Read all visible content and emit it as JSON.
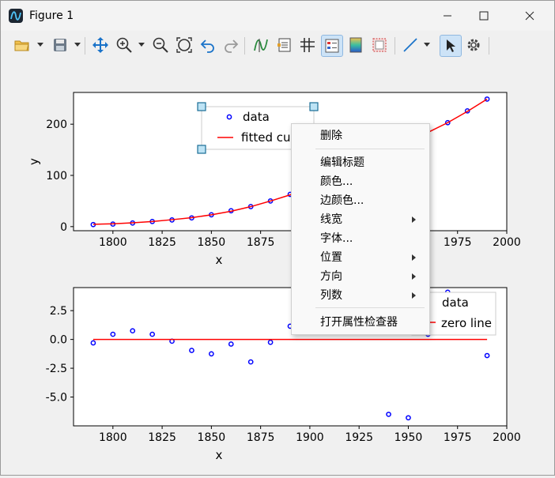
{
  "window": {
    "title": "Figure 1"
  },
  "toolbar": {
    "icons": [
      "open-icon",
      "save-icon",
      "pan-icon",
      "zoom-in-icon",
      "zoom-out-icon",
      "zoom-fit-icon",
      "undo-icon",
      "redo-icon",
      "edit-curve-icon",
      "edit-axes-icon",
      "grid-icon",
      "legend-icon",
      "colorbar-icon",
      "tight-layout-icon",
      "draw-line-icon",
      "pointer-icon",
      "settings-icon"
    ],
    "accent": "#1a73c9"
  },
  "plot_top": {
    "ylabel": "y",
    "xlabel": "x",
    "xticks": [
      "1800",
      "1825",
      "1850",
      "1875",
      "1900",
      "1925",
      "1950",
      "1975",
      "2000"
    ],
    "yticks": [
      "0",
      "100",
      "200"
    ],
    "legend": [
      "data",
      "fitted cu"
    ]
  },
  "plot_bottom": {
    "xlabel": "x",
    "xticks": [
      "1800",
      "1825",
      "1850",
      "1875",
      "1900",
      "1925",
      "1950",
      "1975",
      "2000"
    ],
    "yticks": [
      "2.5",
      "0.0",
      "-2.5",
      "-5.0"
    ],
    "legend": [
      "data",
      "zero line"
    ]
  },
  "chart_data": [
    {
      "type": "scatter",
      "xlim": [
        1780,
        2000
      ],
      "ylim": [
        -8,
        262
      ],
      "series": [
        {
          "name": "data",
          "color": "#0000ff",
          "marker": "circle-open",
          "x": [
            1790,
            1800,
            1810,
            1820,
            1830,
            1840,
            1850,
            1860,
            1870,
            1880,
            1890,
            1970,
            1980,
            1990
          ],
          "y": [
            4,
            5,
            7,
            10,
            13,
            17,
            23,
            31,
            39,
            50,
            63,
            203,
            226,
            249
          ]
        },
        {
          "name": "fitted cu",
          "color": "#ff0000",
          "style": "line",
          "x": [
            1790,
            1800,
            1810,
            1820,
            1830,
            1840,
            1850,
            1860,
            1870,
            1880,
            1890,
            1900,
            1910,
            1920,
            1930,
            1940,
            1950,
            1960,
            1970,
            1980,
            1990
          ],
          "y": [
            4.5,
            5.5,
            7.5,
            10,
            13.5,
            17.5,
            23,
            30,
            39,
            50,
            62,
            76,
            92,
            109,
            127,
            146,
            165,
            184,
            203,
            225,
            249
          ]
        }
      ]
    },
    {
      "type": "scatter",
      "xlim": [
        1780,
        2000
      ],
      "ylim": [
        -7.5,
        4.5
      ],
      "series": [
        {
          "name": "data",
          "color": "#0000ff",
          "marker": "circle-open",
          "x": [
            1790,
            1800,
            1810,
            1820,
            1830,
            1840,
            1850,
            1860,
            1870,
            1880,
            1890,
            1940,
            1950,
            1960,
            1970,
            1990
          ],
          "y": [
            -0.3,
            0.45,
            0.75,
            0.45,
            -0.15,
            -0.95,
            -1.25,
            -0.4,
            -1.95,
            -0.25,
            1.15,
            -6.5,
            -6.8,
            0.45,
            4.1,
            -1.4
          ]
        },
        {
          "name": "zero line",
          "color": "#ff0000",
          "style": "line",
          "x": [
            1790,
            1990
          ],
          "y": [
            0,
            0
          ]
        }
      ]
    }
  ],
  "context_menu": {
    "items": [
      {
        "label": "删除",
        "submenu": false
      },
      {
        "label": "编辑标题",
        "submenu": false
      },
      {
        "label": "颜色...",
        "submenu": false
      },
      {
        "label": "边颜色...",
        "submenu": false
      },
      {
        "label": "线宽",
        "submenu": true
      },
      {
        "label": "字体...",
        "submenu": false
      },
      {
        "label": "位置",
        "submenu": true
      },
      {
        "label": "方向",
        "submenu": true
      },
      {
        "label": "列数",
        "submenu": true
      },
      {
        "label": "打开属性检查器",
        "submenu": false
      }
    ]
  }
}
